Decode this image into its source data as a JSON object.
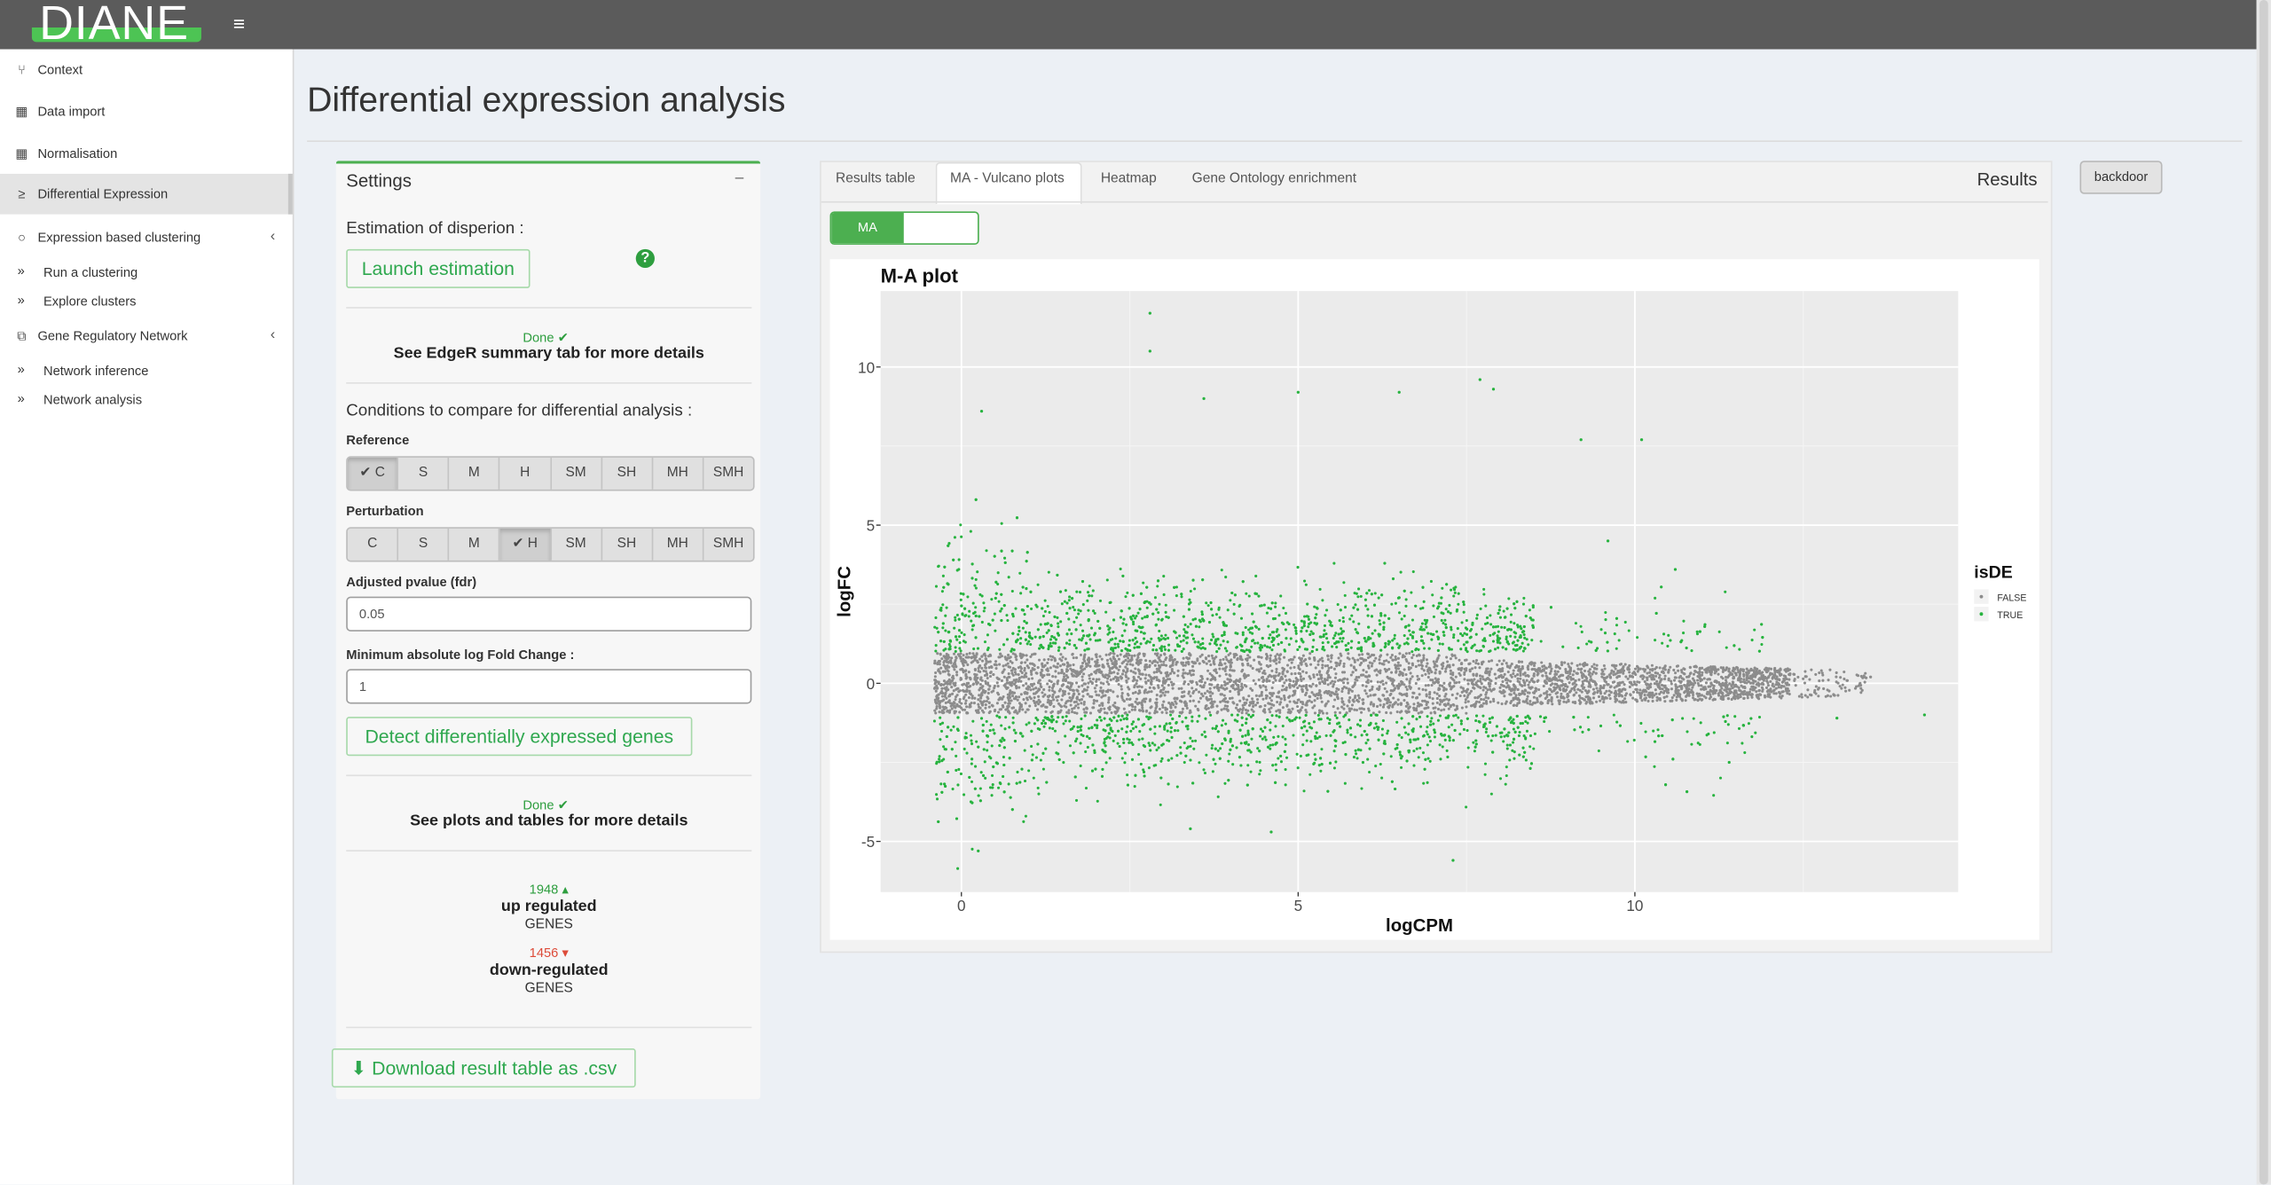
{
  "app": {
    "logo": "DIANE",
    "menu_icon": "hamburger-icon"
  },
  "sidebar": {
    "items": [
      {
        "label": "Context",
        "icon": "branch-icon"
      },
      {
        "label": "Data import",
        "icon": "table-icon"
      },
      {
        "label": "Normalisation",
        "icon": "table-icon"
      },
      {
        "label": "Differential Expression",
        "icon": "sort-icon",
        "active": true
      },
      {
        "label": "Expression based clustering",
        "icon": "circle-notch-icon",
        "expandable": true
      },
      {
        "label": "Gene Regulatory Network",
        "icon": "network-icon",
        "expandable": true
      }
    ],
    "clustering_sub": [
      "Run a clustering",
      "Explore clusters"
    ],
    "network_sub": [
      "Network inference",
      "Network analysis"
    ]
  },
  "page": {
    "title": "Differential expression analysis"
  },
  "settings": {
    "title": "Settings",
    "dispersion_label": "Estimation of disperion :",
    "launch_button": "Launch estimation",
    "done_label": "Done",
    "edger_note": "See EdgeR summary tab for more details",
    "conditions_label": "Conditions to compare for differential analysis :",
    "reference_label": "Reference",
    "perturbation_label": "Perturbation",
    "conditions": [
      "C",
      "S",
      "M",
      "H",
      "SM",
      "SH",
      "MH",
      "SMH"
    ],
    "reference_selected": "C",
    "perturbation_selected": "H",
    "pvalue_label": "Adjusted pvalue (fdr)",
    "pvalue": "0.05",
    "logfc_label": "Minimum absolute log Fold Change :",
    "logfc": "1",
    "detect_button": "Detect differentially expressed genes",
    "done2_label": "Done",
    "plots_note": "See plots and tables for more details",
    "up_count": "1948",
    "up_label": "up regulated",
    "down_count": "1456",
    "down_label": "down-regulated",
    "genes_label": "GENES",
    "download_button": "Download result table as .csv",
    "up_color": "#2e9e3f",
    "down_color": "#dd4b39"
  },
  "results": {
    "tabs": [
      "Results table",
      "MA - Vulcano plots",
      "Heatmap",
      "Gene Ontology enrichment"
    ],
    "active_tab": "MA - Vulcano plots",
    "panel_title": "Results",
    "toggle_label": "MA",
    "backdoor_button": "backdoor"
  },
  "chart_data": {
    "type": "scatter",
    "title": "M-A plot",
    "xlabel": "logCPM",
    "ylabel": "logFC",
    "xlim": [
      -1.2,
      14.8
    ],
    "ylim": [
      -6.6,
      12.4
    ],
    "xticks": [
      0,
      5,
      10
    ],
    "yticks": [
      -5,
      0,
      5,
      10
    ],
    "grid": true,
    "legend": {
      "title": "isDE",
      "entries": [
        "FALSE",
        "TRUE"
      ],
      "placement": "right"
    },
    "series": [
      {
        "name": "FALSE",
        "color": "#8c8c8c",
        "description": "non-DE genes dense band, |logFC| < 1, logCPM -0.4 to 13.5"
      },
      {
        "name": "TRUE",
        "color": "#27b33f",
        "description": "DE genes, |logFC| >= 1, logCPM -0.4 to 14"
      }
    ],
    "highlight_points": [
      {
        "x": 2.8,
        "y": 11.7
      },
      {
        "x": 2.8,
        "y": 10.5
      },
      {
        "x": 3.6,
        "y": 9.0
      },
      {
        "x": 5.0,
        "y": 9.2
      },
      {
        "x": 6.5,
        "y": 9.2
      },
      {
        "x": 7.7,
        "y": 9.6
      },
      {
        "x": 7.9,
        "y": 9.3
      },
      {
        "x": 0.3,
        "y": 8.6
      },
      {
        "x": 9.2,
        "y": 7.7
      },
      {
        "x": 10.1,
        "y": 7.7
      },
      {
        "x": 7.3,
        "y": -5.6
      },
      {
        "x": 0.25,
        "y": -5.3
      },
      {
        "x": 4.6,
        "y": -4.7
      },
      {
        "x": 13.5,
        "y": 0.2
      },
      {
        "x": 14.3,
        "y": -1.0
      },
      {
        "x": 13.0,
        "y": -1.1
      },
      {
        "x": 10.6,
        "y": 3.6
      },
      {
        "x": 9.6,
        "y": 4.5
      },
      {
        "x": 11.4,
        "y": -2.5
      },
      {
        "x": 3.4,
        "y": -4.6
      }
    ]
  }
}
